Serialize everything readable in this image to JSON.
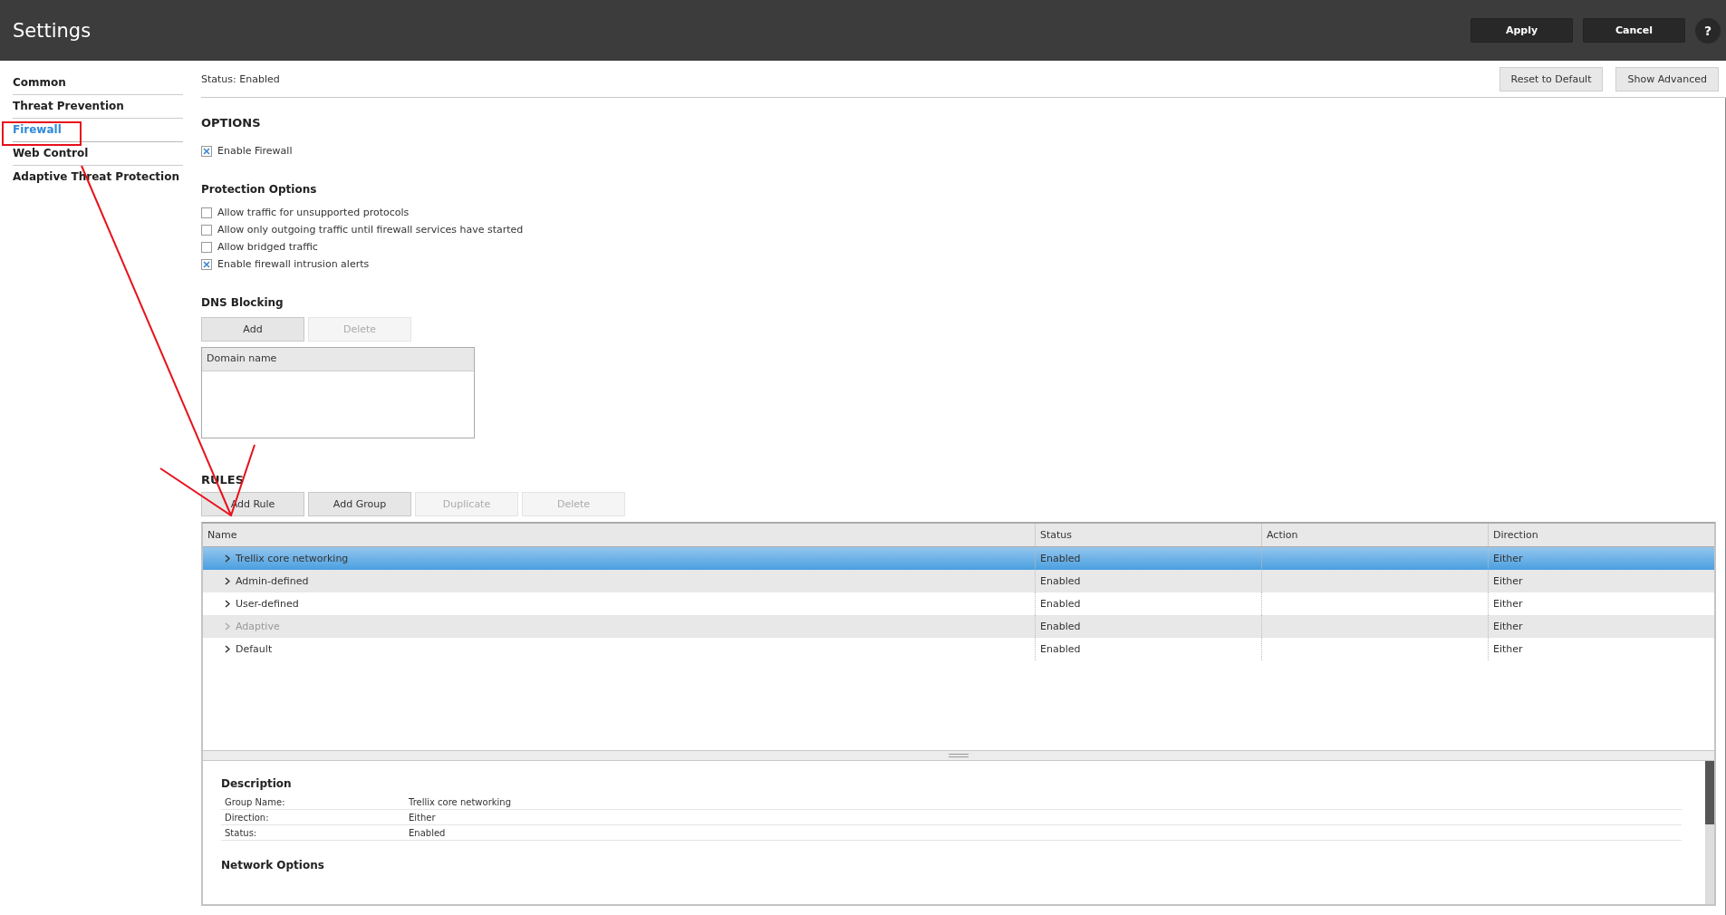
{
  "header": {
    "title": "Settings",
    "buttons": [
      "Apply",
      "Cancel"
    ],
    "help": "?"
  },
  "sidebar": {
    "items": [
      {
        "label": "Common",
        "selected": false
      },
      {
        "label": "Threat Prevention",
        "selected": false
      },
      {
        "label": "Firewall",
        "selected": true
      },
      {
        "label": "Web Control",
        "selected": false
      },
      {
        "label": "Adaptive Threat Protection",
        "selected": false
      }
    ]
  },
  "status": "Status: Enabled",
  "top_buttons": [
    "Reset to Default",
    "Show Advanced"
  ],
  "options": {
    "heading": "OPTIONS",
    "items": [
      {
        "label": "Enable Firewall",
        "checked": true
      }
    ]
  },
  "protection_options": {
    "heading": "Protection Options",
    "items": [
      {
        "label": "Allow traffic for unsupported protocols",
        "checked": false
      },
      {
        "label": "Allow only outgoing traffic until firewall services have started",
        "checked": false
      },
      {
        "label": "Allow bridged traffic",
        "checked": false
      },
      {
        "label": "Enable firewall intrusion alerts",
        "checked": true
      }
    ]
  },
  "dns_blocking": {
    "heading": "DNS Blocking",
    "buttons": [
      {
        "label": "Add",
        "disabled": false
      },
      {
        "label": "Delete",
        "disabled": true
      }
    ],
    "column": "Domain name"
  },
  "rules": {
    "heading": "RULES",
    "buttons": [
      {
        "label": "Add Rule",
        "disabled": false
      },
      {
        "label": "Add Group",
        "disabled": false
      },
      {
        "label": "Duplicate",
        "disabled": true
      },
      {
        "label": "Delete",
        "disabled": true
      }
    ],
    "columns": [
      "Name",
      "Status",
      "Action",
      "Direction"
    ],
    "rows": [
      {
        "name": "Trellix core networking",
        "status": "Enabled",
        "direction": "Either",
        "selected": true,
        "disabled": false
      },
      {
        "name": "Admin-defined",
        "status": "Enabled",
        "direction": "Either",
        "selected": false,
        "disabled": false
      },
      {
        "name": "User-defined",
        "status": "Enabled",
        "direction": "Either",
        "selected": false,
        "disabled": false
      },
      {
        "name": "Adaptive",
        "status": "Enabled",
        "direction": "Either",
        "selected": false,
        "disabled": true
      },
      {
        "name": "Default",
        "status": "Enabled",
        "direction": "Either",
        "selected": false,
        "disabled": false
      }
    ]
  },
  "description": {
    "heading": "Description",
    "fields": [
      {
        "label": "Group Name:",
        "value": "Trellix core networking"
      },
      {
        "label": "Direction:",
        "value": "Either"
      },
      {
        "label": "Status:",
        "value": "Enabled"
      }
    ],
    "section": "Network Options"
  }
}
